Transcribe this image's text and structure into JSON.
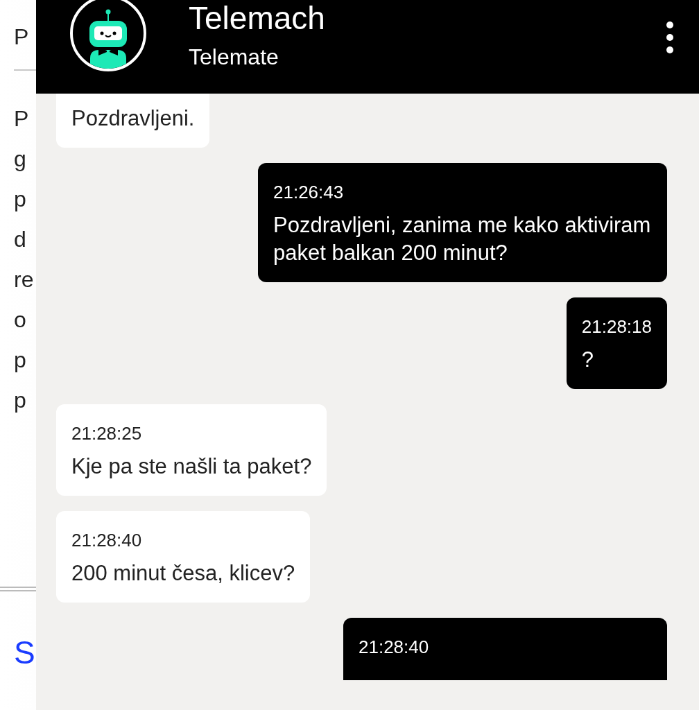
{
  "background_page": {
    "subtitle": "P",
    "paragraph_lines": [
      "P",
      "g",
      "p",
      "d",
      "re",
      "o",
      "p",
      "p"
    ],
    "link": "S"
  },
  "chat": {
    "title": "Telemach",
    "subtitle": "Telemate",
    "messages": [
      {
        "kind": "bot",
        "text": "Pozdravljeni."
      },
      {
        "kind": "user",
        "time": "21:26:43",
        "text": "Pozdravljeni, zanima me kako aktiviram paket balkan 200 minut?"
      },
      {
        "kind": "user",
        "time": "21:28:18",
        "text": "?"
      },
      {
        "kind": "bot",
        "time": "21:28:25",
        "text": "Kje pa ste našli ta paket?"
      },
      {
        "kind": "bot",
        "time": "21:28:40",
        "text": "200 minut česa, klicev?"
      },
      {
        "kind": "user",
        "time": "21:28:40"
      }
    ]
  }
}
